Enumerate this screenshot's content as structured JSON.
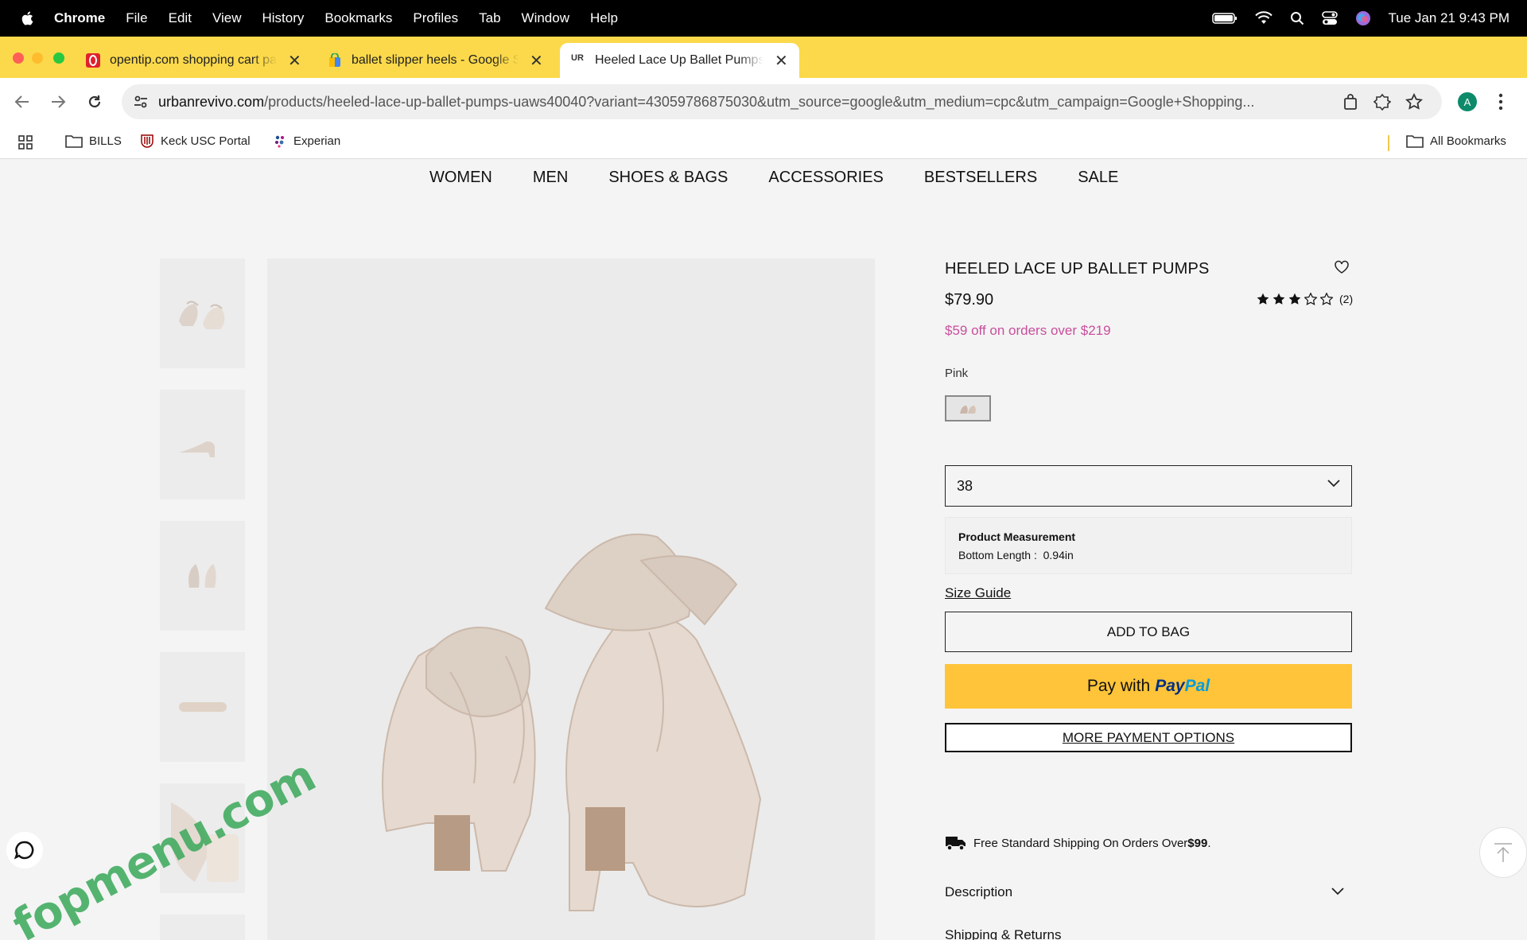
{
  "menubar": {
    "app": "Chrome",
    "items": [
      "File",
      "Edit",
      "View",
      "History",
      "Bookmarks",
      "Profiles",
      "Tab",
      "Window",
      "Help"
    ],
    "datetime": "Tue Jan 21  9:43 PM"
  },
  "tabs": [
    {
      "title": "opentip.com shopping cart pa",
      "active": false
    },
    {
      "title": "ballet slipper heels - Google S",
      "active": false
    },
    {
      "title": "Heeled Lace Up Ballet Pumps",
      "active": true
    }
  ],
  "toolbar": {
    "url_host": "urbanrevivo.com",
    "url_path": "/products/heeled-lace-up-ballet-pumps-uaws40040?variant=43059786875030&utm_source=google&utm_medium=cpc&utm_campaign=Google+Shopping...",
    "profile_initial": "A"
  },
  "bookmarks": {
    "items": [
      "BILLS",
      "Keck USC Portal",
      "Experian"
    ],
    "all": "All Bookmarks"
  },
  "site_nav": [
    "WOMEN",
    "MEN",
    "SHOES & BAGS",
    "ACCESSORIES",
    "BESTSELLERS",
    "SALE"
  ],
  "product": {
    "title": "HEELED LACE UP BALLET PUMPS",
    "price": "$79.90",
    "rating": 3,
    "rating_max": 5,
    "review_count": "(2)",
    "promo": "$59 off on orders over $219",
    "color": "Pink",
    "size": "38",
    "measurement_title": "Product Measurement",
    "measurement_label": "Bottom Length :",
    "measurement_value": "0.94in",
    "size_guide": "Size Guide",
    "add_to_bag": "ADD TO BAG",
    "pay_with": "Pay with",
    "paypal_1": "Pay",
    "paypal_2": "Pal",
    "more_payment": "MORE PAYMENT OPTIONS",
    "shipping_text": "Free Standard Shipping On Orders Over ",
    "shipping_amount": "$99",
    "shipping_end": ".",
    "description": "Description",
    "shipping_returns": "Shipping & Returns"
  },
  "watermark": "fopmenu.com",
  "colors": {
    "tab_strip": "#fbd94a",
    "promo": "#c84f9c",
    "paypal": "#ffc439"
  }
}
